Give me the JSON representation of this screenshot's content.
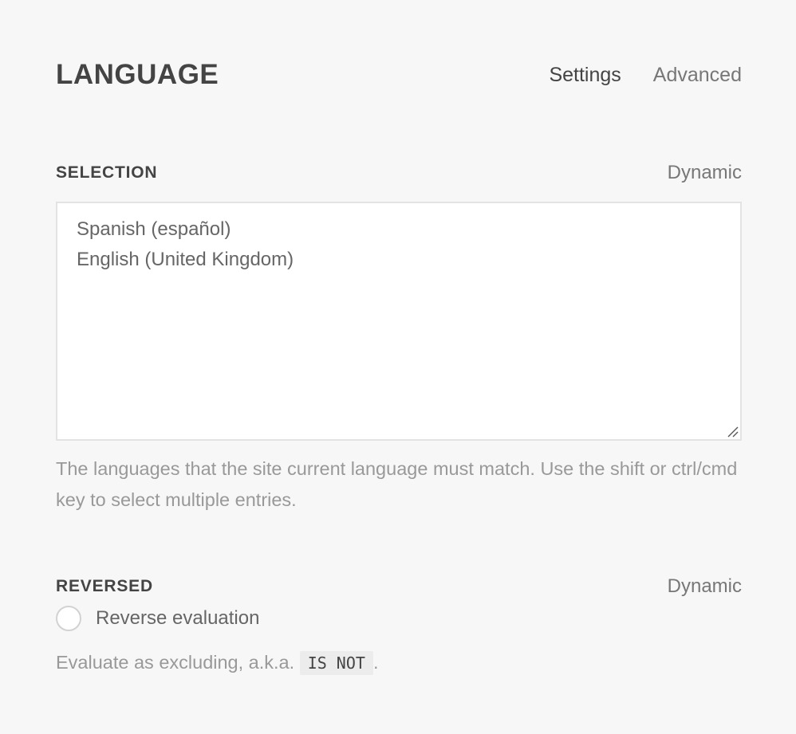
{
  "header": {
    "title": "LANGUAGE",
    "tabs": [
      {
        "label": "Settings",
        "active": true
      },
      {
        "label": "Advanced",
        "active": false
      }
    ]
  },
  "selection": {
    "label": "SELECTION",
    "dynamic_label": "Dynamic",
    "options": [
      "Spanish (español)",
      "English (United Kingdom)"
    ],
    "help": "The languages that the site current language must match. Use the shift or ctrl/cmd key to select multiple entries."
  },
  "reversed": {
    "label": "REVERSED",
    "dynamic_label": "Dynamic",
    "checkbox_label": "Reverse evaluation",
    "checked": false,
    "help_prefix": "Evaluate as excluding, a.k.a.",
    "help_code": "IS NOT",
    "help_suffix": "."
  },
  "colors": {
    "background": "#f7f7f7",
    "text": "#444444",
    "muted": "#999999"
  }
}
